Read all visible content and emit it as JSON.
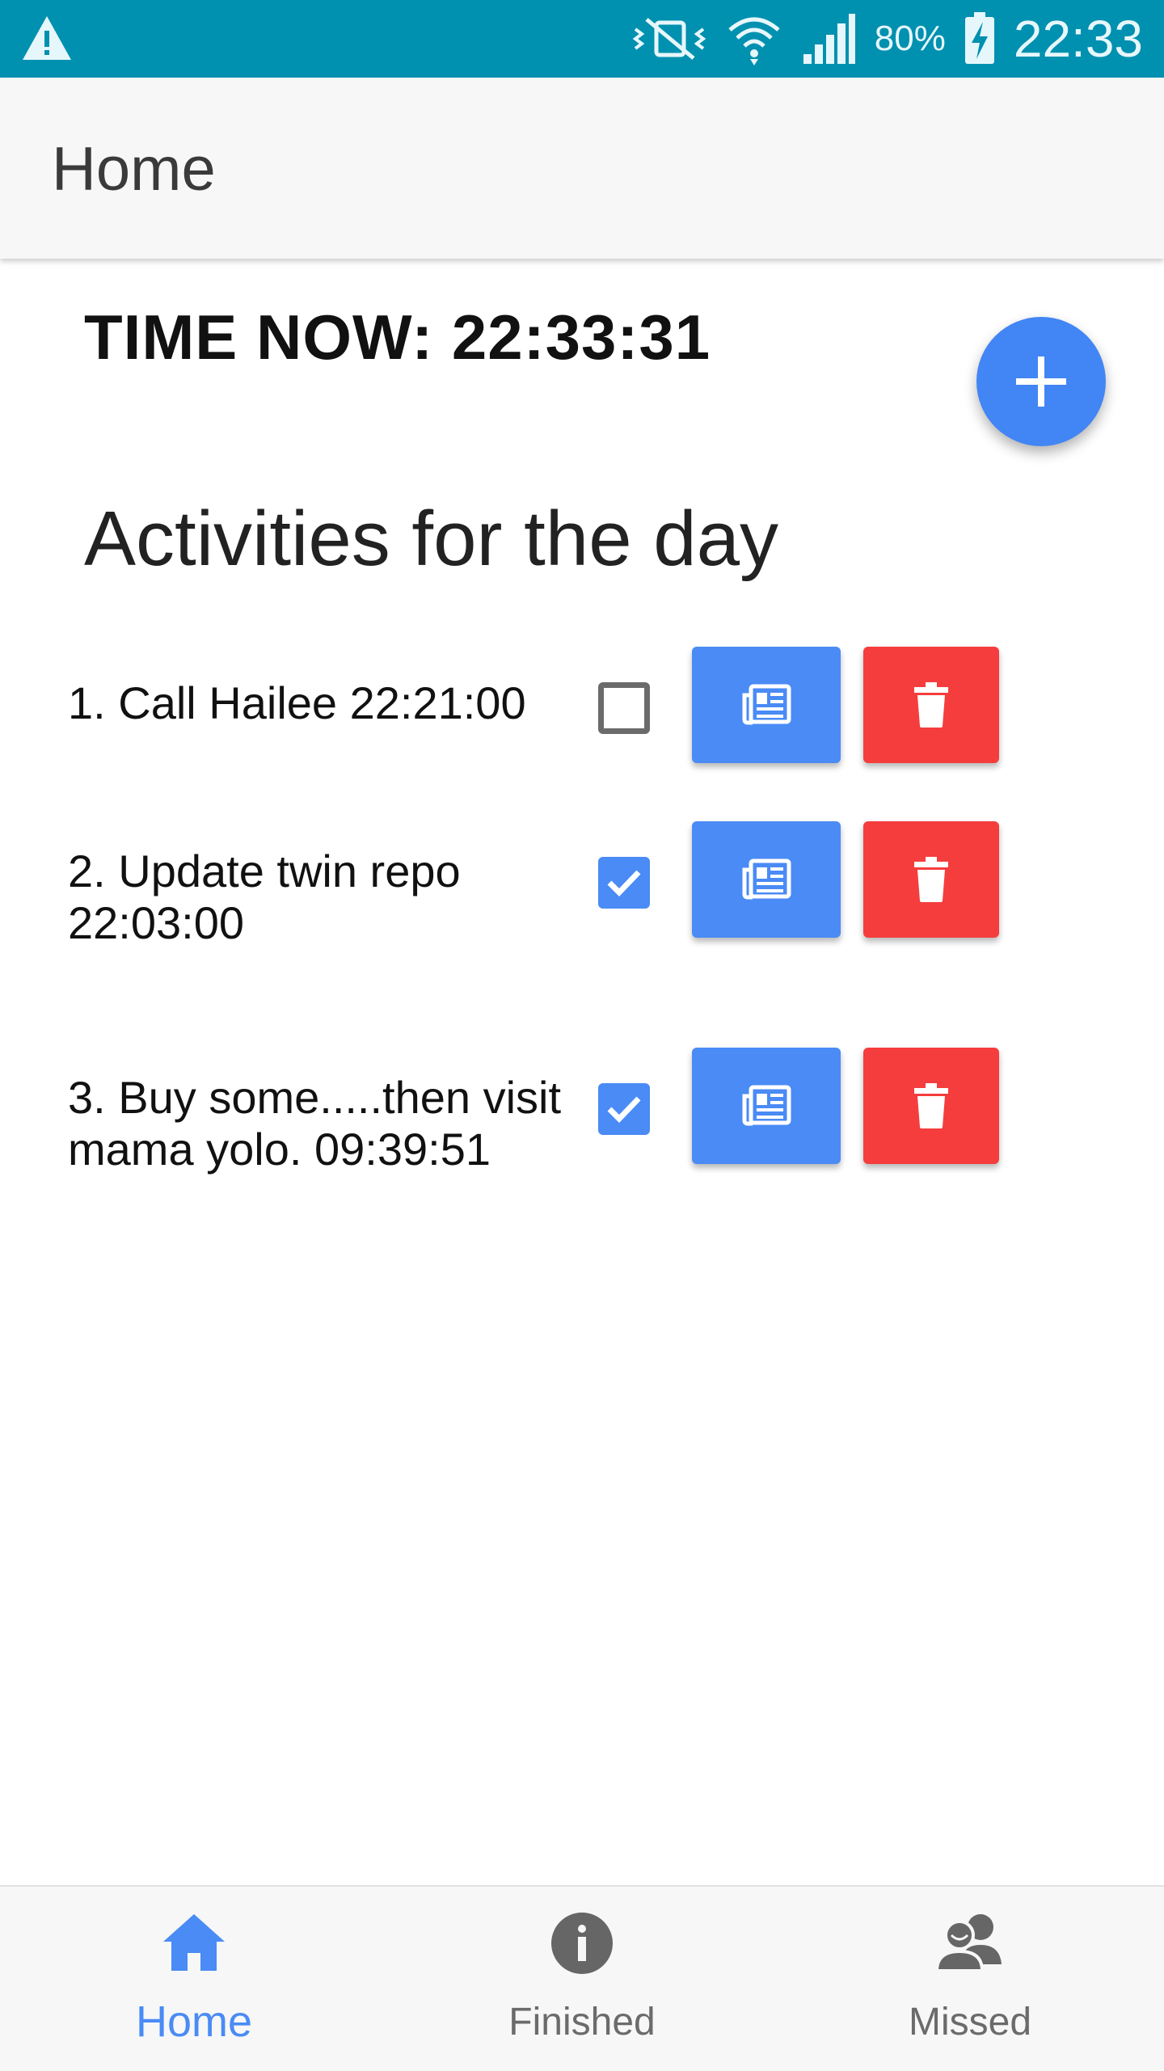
{
  "status_bar": {
    "battery_percent": "80%",
    "time": "22:33"
  },
  "app_bar": {
    "title": "Home"
  },
  "main": {
    "time_now": "TIME NOW: 22:33:31",
    "section_heading": "Activities for the day",
    "activities": [
      {
        "text": "1. Call Hailee 22:21:00",
        "checked": false
      },
      {
        "text": "2. Update twin repo 22:03:00",
        "checked": true
      },
      {
        "text": "3. Buy some.....then visit mama yolo. 09:39:51",
        "checked": true
      }
    ]
  },
  "bottom_nav": {
    "items": [
      {
        "label": "Home",
        "icon": "home-icon",
        "active": true
      },
      {
        "label": "Finished",
        "icon": "info-icon",
        "active": false
      },
      {
        "label": "Missed",
        "icon": "people-icon",
        "active": false
      }
    ]
  },
  "colors": {
    "status_bar": "#0090B0",
    "accent_blue": "#4A8BF5",
    "fab_blue": "#4285F4",
    "delete_red": "#F53D3D"
  }
}
